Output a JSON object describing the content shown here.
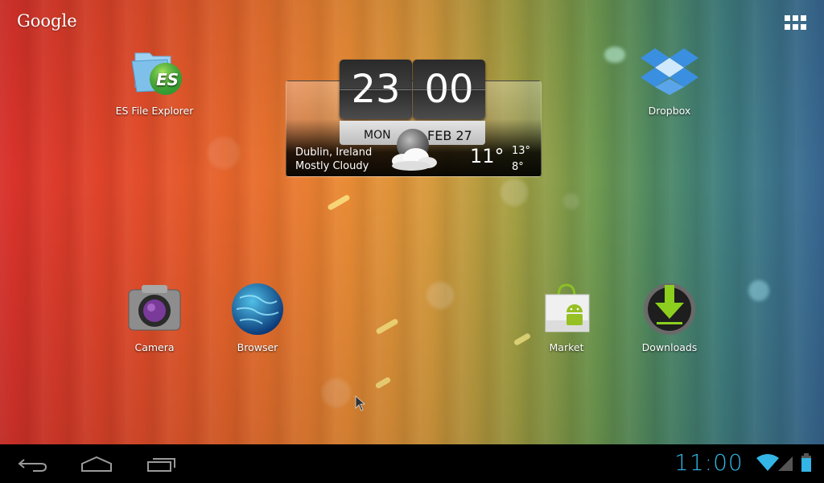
{
  "wallpaper": {
    "name": "Android ICS default wallpaper"
  },
  "search_widget": {
    "label": "Google"
  },
  "all_apps": {
    "label": "All apps",
    "icon": "grid-icon"
  },
  "apps": [
    {
      "id": "es-file-explorer",
      "label": "ES File Explorer",
      "icon": "es-file-explorer-icon"
    },
    {
      "id": "dropbox",
      "label": "Dropbox",
      "icon": "dropbox-icon"
    },
    {
      "id": "camera",
      "label": "Camera",
      "icon": "camera-icon"
    },
    {
      "id": "browser",
      "label": "Browser",
      "icon": "globe-icon"
    },
    {
      "id": "market",
      "label": "Market",
      "icon": "shopping-bag-icon"
    },
    {
      "id": "downloads",
      "label": "Downloads",
      "icon": "download-icon"
    }
  ],
  "clock_widget": {
    "hour": "23",
    "minute": "00",
    "day": "MON",
    "date": "FEB 27",
    "location": "Dublin, Ireland",
    "condition": "Mostly Cloudy",
    "temperature": "11°",
    "high": "13°",
    "low": "8°",
    "weather_icon": "cloudy-night-icon"
  },
  "navbar": {
    "back": "Back",
    "home": "Home",
    "recents": "Recent apps"
  },
  "status": {
    "time": "11:00",
    "wifi": "wifi-icon",
    "signal": "signal-icon",
    "battery": "battery-icon",
    "accent_color": "#33b5e5"
  }
}
